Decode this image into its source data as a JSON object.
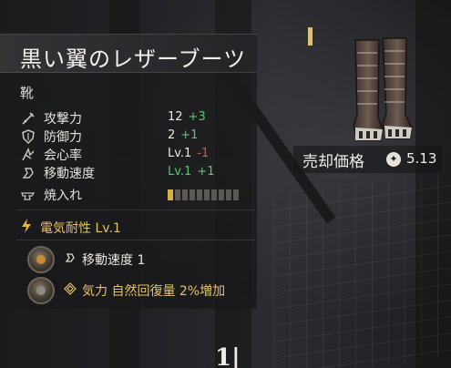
{
  "item": {
    "name": "黒い翼のレザーブーツ",
    "type": "靴"
  },
  "stats": [
    {
      "icon": "sword-icon",
      "label": "攻撃力",
      "value": "12",
      "delta": "+3",
      "delta_dir": "up"
    },
    {
      "icon": "shield-icon",
      "label": "防御力",
      "value": "2",
      "delta": "+1",
      "delta_dir": "up"
    },
    {
      "icon": "crit-icon",
      "label": "会心率",
      "value": "Lv.1",
      "delta": "-1",
      "delta_dir": "down"
    },
    {
      "icon": "speed-icon",
      "label": "移動速度",
      "value": "Lv.1",
      "delta": "+1",
      "delta_dir": "up"
    }
  ],
  "tempering": {
    "icon": "anvil-icon",
    "label": "焼入れ",
    "filled": 1,
    "total": 10
  },
  "element": {
    "icon": "lightning-icon",
    "label": "電気耐性 Lv.1"
  },
  "gems": [
    {
      "icon": "speed-icon",
      "text": "移動速度 1",
      "style": "normal"
    },
    {
      "icon": "diamond-icon",
      "text": "気力 自然回復量 2%増加",
      "style": "gold"
    }
  ],
  "sell": {
    "label": "売却価格",
    "coin_icon": "coin-icon",
    "price": "5.13"
  },
  "bottom_mark": "1|",
  "colors": {
    "positive": "#58c86a",
    "negative": "#e0554c",
    "gold": "#e3c266"
  }
}
